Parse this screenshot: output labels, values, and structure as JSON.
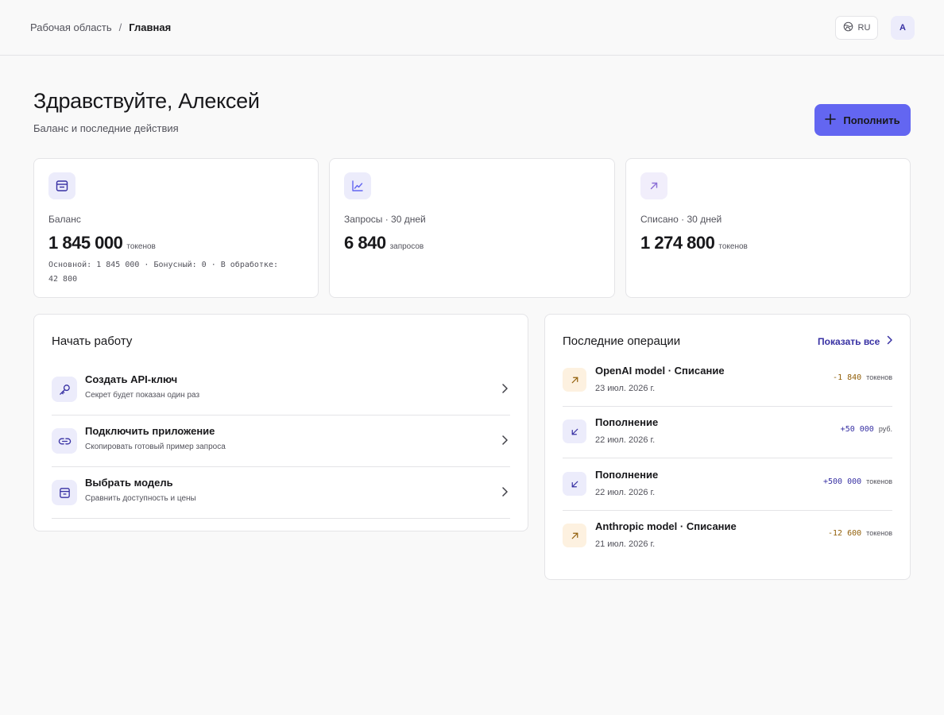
{
  "breadcrumb": {
    "workspace": "Рабочая область",
    "separator": "/",
    "current": "Главная"
  },
  "topbar": {
    "language": "RU",
    "avatar_initial": "A"
  },
  "header": {
    "title": "Здравствуйте, Алексей",
    "subtitle": "Баланс и последние действия",
    "topup_label": "Пополнить"
  },
  "stats": [
    {
      "label": "Баланс",
      "value": "1 845 000",
      "unit": "токенов",
      "detail": "Основной: 1 845 000 · Бонусный: 0 · В обработке: 42 800"
    },
    {
      "label": "Запросы · 30 дней",
      "value": "6 840",
      "unit": "запросов"
    },
    {
      "label": "Списано · 30 дней",
      "value": "1 274 800",
      "unit": "токенов"
    }
  ],
  "getting_started": {
    "title": "Начать работу",
    "items": [
      {
        "title": "Создать API-ключ",
        "desc": "Секрет будет показан один раз"
      },
      {
        "title": "Подключить приложение",
        "desc": "Скопировать готовый пример запроса"
      },
      {
        "title": "Выбрать модель",
        "desc": "Сравнить доступность и цены"
      }
    ]
  },
  "operations": {
    "title": "Последние операции",
    "show_all": "Показать все",
    "items": [
      {
        "title": "OpenAI model · Списание",
        "date": "23 июл. 2026 г.",
        "amount": "-1 840",
        "unit": "токенов"
      },
      {
        "title": "Пополнение",
        "date": "22 июл. 2026 г.",
        "amount": "+50 000",
        "unit": "руб."
      },
      {
        "title": "Пополнение",
        "date": "22 июл. 2026 г.",
        "amount": "+500 000",
        "unit": "токенов"
      },
      {
        "title": "Anthropic model · Списание",
        "date": "21 июл. 2026 г.",
        "amount": "-12 600",
        "unit": "токенов"
      }
    ]
  },
  "colors": {
    "accent": "#6366f1",
    "debit": "#92600b",
    "credit": "#3730a3",
    "debit_bg": "#fdf1e0",
    "credit_bg": "#ececfb"
  }
}
